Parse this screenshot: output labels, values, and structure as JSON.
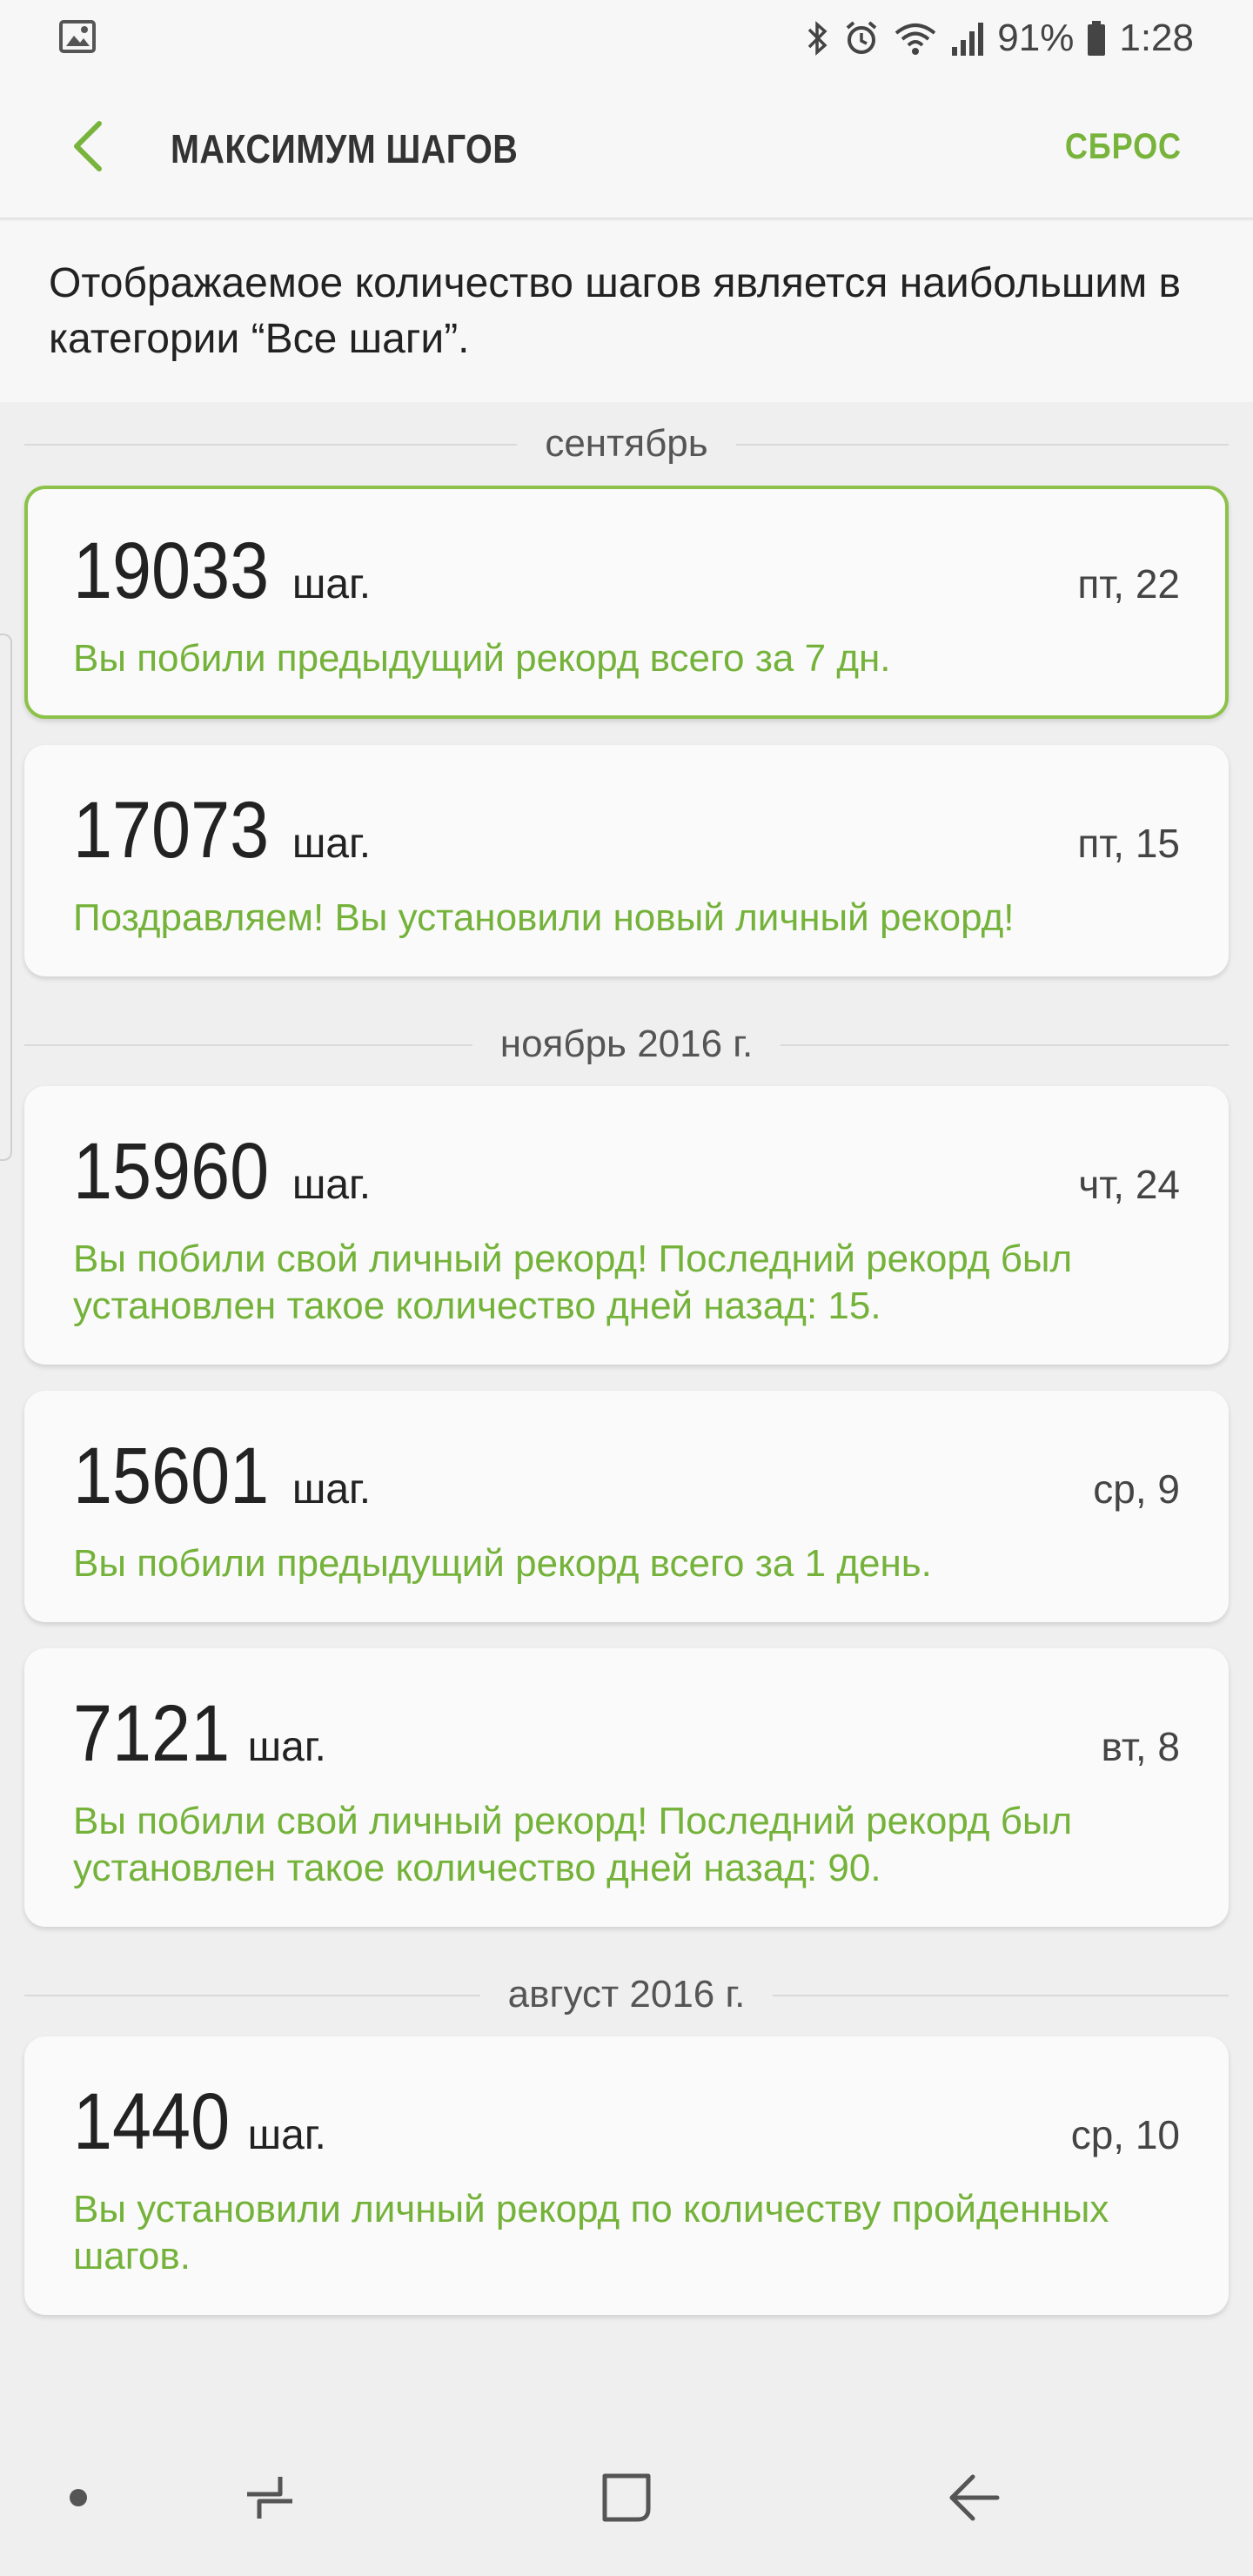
{
  "status_bar": {
    "battery": "91%",
    "time": "1:28"
  },
  "header": {
    "title": "МАКСИМУМ ШАГОВ",
    "reset_label": "СБРОС"
  },
  "description": "Отображаемое количество шагов является наибольшим в категории “Все шаги”.",
  "sections": [
    {
      "label": "сентябрь",
      "cards": [
        {
          "steps": "19033",
          "unit": "шаг.",
          "date": "пт, 22",
          "message": "Вы побили предыдущий рекорд всего за 7 дн.",
          "highlighted": true
        },
        {
          "steps": "17073",
          "unit": "шаг.",
          "date": "пт, 15",
          "message": "Поздравляем! Вы установили новый личный рекорд!"
        }
      ]
    },
    {
      "label": "ноябрь 2016 г.",
      "cards": [
        {
          "steps": "15960",
          "unit": "шаг.",
          "date": "чт, 24",
          "message": "Вы побили свой личный рекорд! Последний рекорд был установлен такое количество дней назад: 15."
        },
        {
          "steps": "15601",
          "unit": "шаг.",
          "date": "ср, 9",
          "message": "Вы побили предыдущий рекорд всего за 1 день."
        },
        {
          "steps": "7121",
          "unit": "шаг.",
          "date": "вт, 8",
          "message": "Вы побили свой личный рекорд! Последний рекорд был установлен такое количество дней назад: 90."
        }
      ]
    },
    {
      "label": "август 2016 г.",
      "cards": [
        {
          "steps": "1440",
          "unit": "шаг.",
          "date": "ср, 10",
          "message": "Вы установили личный рекорд по количеству пройденных шагов."
        }
      ]
    }
  ],
  "colors": {
    "accent": "#78b43c",
    "message": "#74b23a",
    "background": "#efefef"
  },
  "icons": {
    "status_left": "gallery-notification-icon",
    "status_right": [
      "bluetooth-icon",
      "alarm-icon",
      "wifi-icon",
      "signal-icon",
      "battery-icon"
    ],
    "nav": [
      "dot-icon",
      "recent-apps-icon",
      "home-icon",
      "back-icon"
    ]
  }
}
